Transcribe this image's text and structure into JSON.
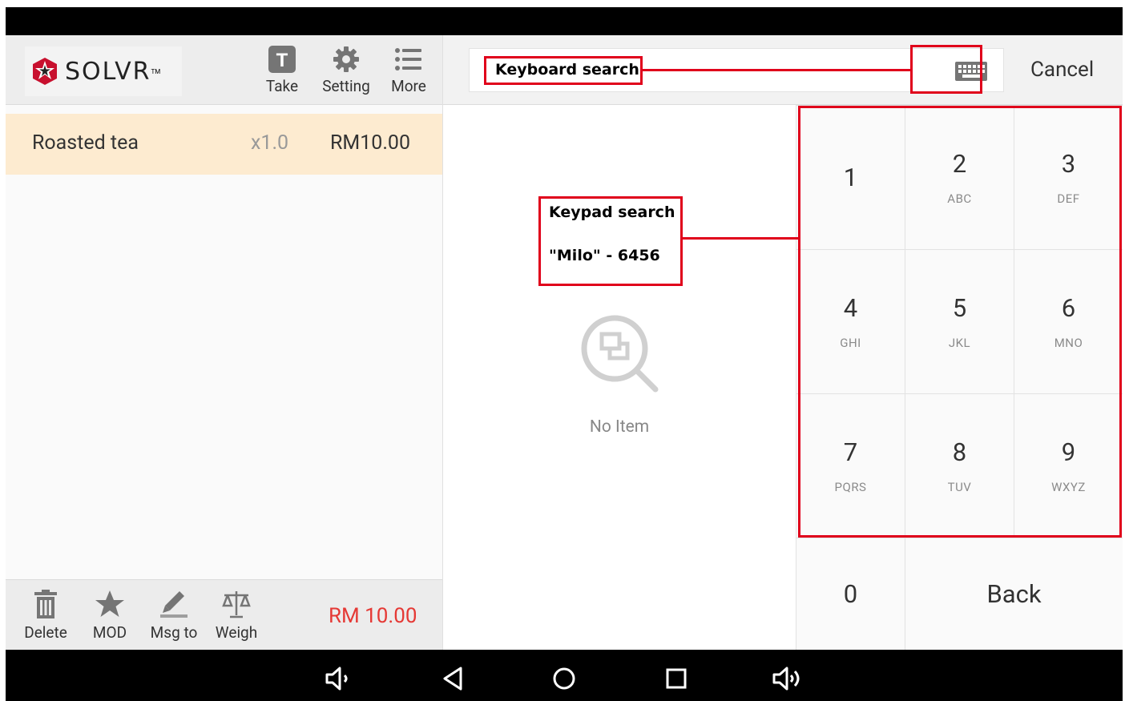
{
  "brand": {
    "name": "SOLVR",
    "tm": "TM"
  },
  "toolbar": {
    "take_label": "Take",
    "setting_label": "Setting",
    "more_label": "More"
  },
  "order": {
    "items": [
      {
        "name": "Roasted tea",
        "qty": "x1.0",
        "price": "RM10.00"
      }
    ],
    "total": "RM 10.00"
  },
  "bottom_actions": {
    "delete_label": "Delete",
    "mod_label": "MOD",
    "msg_label": "Msg to",
    "weigh_label": "Weigh"
  },
  "search": {
    "cancel_label": "Cancel",
    "empty_text": "No Item"
  },
  "keypad": {
    "keys": [
      {
        "num": "1",
        "letters": ""
      },
      {
        "num": "2",
        "letters": "ABC"
      },
      {
        "num": "3",
        "letters": "DEF"
      },
      {
        "num": "4",
        "letters": "GHI"
      },
      {
        "num": "5",
        "letters": "JKL"
      },
      {
        "num": "6",
        "letters": "MNO"
      },
      {
        "num": "7",
        "letters": "PQRS"
      },
      {
        "num": "8",
        "letters": "TUV"
      },
      {
        "num": "9",
        "letters": "WXYZ"
      },
      {
        "num": "0",
        "letters": ""
      }
    ],
    "back_label": "Back"
  },
  "annotations": {
    "keyboard_search": "Keyboard search",
    "keypad_search_title": "Keypad search",
    "keypad_search_example": "\"Milo\" - 6456"
  },
  "colors": {
    "annotation_red": "#e0001b",
    "total_red": "#e53935",
    "selected_row": "#fdebd0"
  }
}
